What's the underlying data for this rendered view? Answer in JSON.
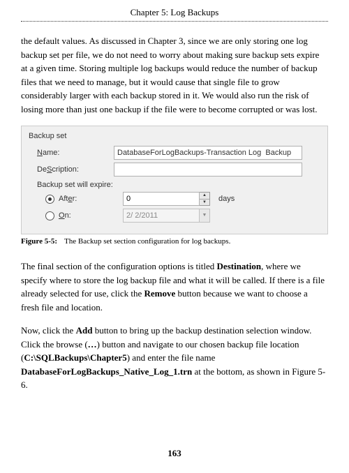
{
  "header": {
    "chapter": "Chapter 5: Log Backups"
  },
  "paragraphs": {
    "p1": "the default values. As discussed in Chapter 3, since we are only storing one log backup set per file, we do not need to worry about making sure backup sets expire at a given time. Storing multiple log backups would reduce the number of backup files that we need to manage, but it would cause that single file to grow considerably larger with each backup stored in it. We would also run the risk of losing more than just one backup if the file were to become corrupted or was lost.",
    "p2a": "The final section of the configuration options is titled ",
    "p2b": "Destination",
    "p2c": ", where we specify where to store the log backup file and what it will be called. If there is a file already selected for use, click the ",
    "p2d": "Remove",
    "p2e": " button because we want to choose a fresh file and location.",
    "p3a": "Now, click the ",
    "p3b": "Add",
    "p3c": " button to bring up the backup destination selection window. Click the browse (",
    "p3d": "…",
    "p3e": ") button and navigate to our chosen backup file location (",
    "p3f": "C:\\SQLBackups\\Chapter5",
    "p3g": ") and enter the file name ",
    "p3h": "DatabaseForLogBackups_Native_Log_1.trn",
    "p3i": " at the bottom, as shown in Figure 5-6."
  },
  "panel": {
    "title": "Backup set",
    "name_label": "Name:",
    "name_underline": "N",
    "name_value": "DatabaseForLogBackups-Transaction Log  Backup",
    "desc_label": "Description:",
    "desc_underline": "S",
    "desc_value": "",
    "expire_label": "Backup set will expire:",
    "after_label": "After:",
    "after_underline": "e",
    "after_value": "0",
    "days_label": "days",
    "on_label": "On:",
    "on_underline": "O",
    "on_value": "2/ 2/2011"
  },
  "caption": {
    "label": "Figure 5-5:",
    "text": "The Backup set section configuration for log backups."
  },
  "page_number": "163"
}
